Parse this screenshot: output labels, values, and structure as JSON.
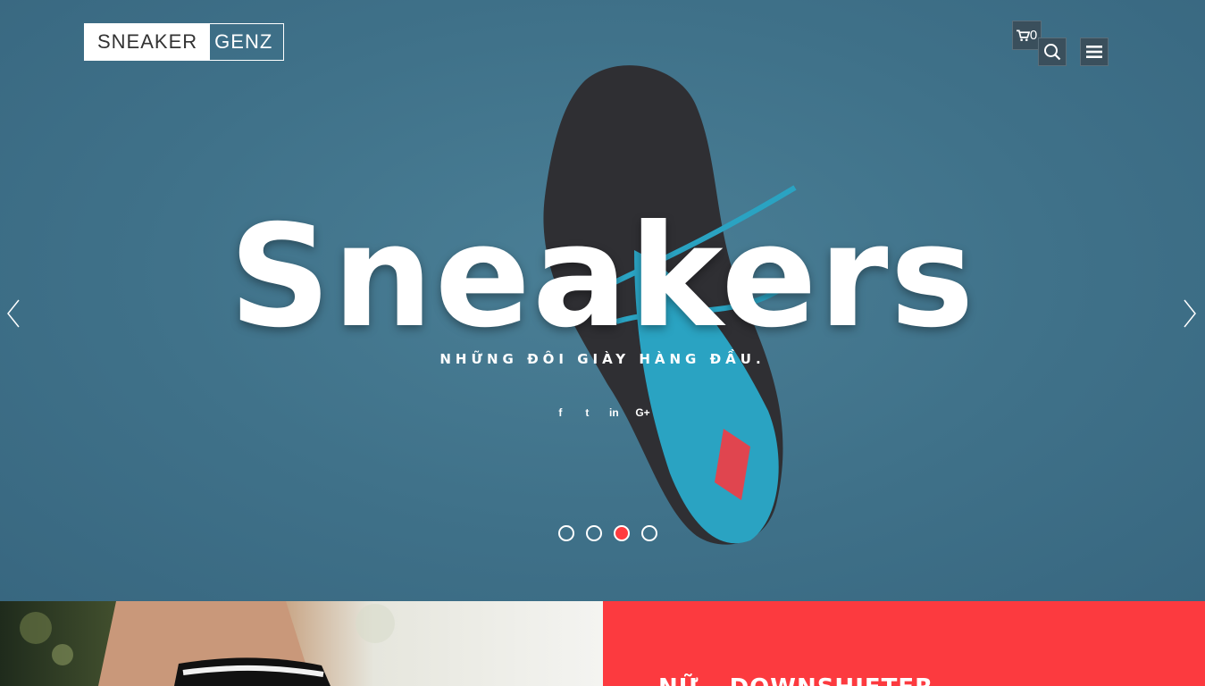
{
  "brand": {
    "part1": "SNEAKER",
    "part2": "GENZ"
  },
  "header": {
    "cart_count": "0",
    "icons": {
      "cart": "cart-icon",
      "search": "search-icon",
      "menu": "hamburger-menu-icon"
    }
  },
  "hero": {
    "headline": "Sneakers",
    "subheadline": "NHỮNG ĐÔI GIÀY HÀNG ĐẦU.",
    "social": [
      {
        "icon": "facebook-icon",
        "glyph": "f"
      },
      {
        "icon": "twitter-icon",
        "glyph": "t"
      },
      {
        "icon": "linkedin-icon",
        "glyph": "in"
      },
      {
        "icon": "google-plus-icon",
        "glyph": "G+"
      }
    ],
    "slides_total": 4,
    "active_slide": 3,
    "colors": {
      "background": "#3f7189",
      "accent": "#fc3a3f"
    }
  },
  "feature": {
    "title": "NỮ – DOWNSHIFTER"
  }
}
